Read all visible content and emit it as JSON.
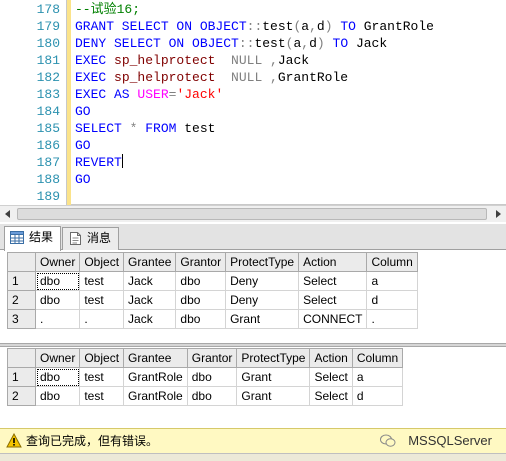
{
  "editor": {
    "line_numbers": [
      "178",
      "179",
      "180",
      "181",
      "182",
      "183",
      "184",
      "185",
      "186",
      "187",
      "188",
      "189"
    ],
    "lines": [
      [
        {
          "t": "--试验16;",
          "c": "cm"
        }
      ],
      [
        {
          "t": "GRANT SELECT ON OBJECT",
          "c": "kw"
        },
        {
          "t": "::",
          "c": "gr"
        },
        {
          "t": "test",
          "c": "df"
        },
        {
          "t": "(",
          "c": "gr"
        },
        {
          "t": "a",
          "c": "df"
        },
        {
          "t": ",",
          "c": "gr"
        },
        {
          "t": "d",
          "c": "df"
        },
        {
          "t": ")",
          "c": "gr"
        },
        {
          "t": " TO ",
          "c": "kw"
        },
        {
          "t": "GrantRole",
          "c": "df"
        }
      ],
      [
        {
          "t": "DENY SELECT ON OBJECT",
          "c": "kw"
        },
        {
          "t": "::",
          "c": "gr"
        },
        {
          "t": "test",
          "c": "df"
        },
        {
          "t": "(",
          "c": "gr"
        },
        {
          "t": "a",
          "c": "df"
        },
        {
          "t": ",",
          "c": "gr"
        },
        {
          "t": "d",
          "c": "df"
        },
        {
          "t": ")",
          "c": "gr"
        },
        {
          "t": " TO ",
          "c": "kw"
        },
        {
          "t": "Jack",
          "c": "df"
        }
      ],
      [
        {
          "t": "EXEC ",
          "c": "kw"
        },
        {
          "t": "sp_helprotect",
          "c": "fn"
        },
        {
          "t": "  NULL ,",
          "c": "gr"
        },
        {
          "t": "Jack",
          "c": "df"
        }
      ],
      [
        {
          "t": "EXEC ",
          "c": "kw"
        },
        {
          "t": "sp_helprotect",
          "c": "fn"
        },
        {
          "t": "  NULL ,",
          "c": "gr"
        },
        {
          "t": "GrantRole",
          "c": "df"
        }
      ],
      [
        {
          "t": "EXEC AS ",
          "c": "kw"
        },
        {
          "t": "USER",
          "c": "mg"
        },
        {
          "t": "=",
          "c": "gr"
        },
        {
          "t": "'Jack'",
          "c": "st"
        }
      ],
      [
        {
          "t": "GO",
          "c": "kw"
        }
      ],
      [
        {
          "t": "SELECT ",
          "c": "kw"
        },
        {
          "t": "*",
          "c": "gr"
        },
        {
          "t": " FROM ",
          "c": "kw"
        },
        {
          "t": "test",
          "c": "df"
        }
      ],
      [
        {
          "t": "GO",
          "c": "kw"
        }
      ],
      [
        {
          "t": "REVERT",
          "c": "kw"
        }
      ],
      [
        {
          "t": "GO",
          "c": "kw"
        }
      ],
      []
    ]
  },
  "tabs": {
    "results": "结果",
    "messages": "消息"
  },
  "grid1": {
    "columns": [
      "Owner",
      "Object",
      "Grantee",
      "Grantor",
      "ProtectType",
      "Action",
      "Column"
    ],
    "rows": [
      {
        "n": "1",
        "cells": [
          "dbo",
          "test",
          "Jack",
          "dbo",
          "Deny",
          "Select",
          "a"
        ]
      },
      {
        "n": "2",
        "cells": [
          "dbo",
          "test",
          "Jack",
          "dbo",
          "Deny",
          "Select",
          "d"
        ]
      },
      {
        "n": "3",
        "cells": [
          ".",
          ".",
          "Jack",
          "dbo",
          "Grant",
          "CONNECT",
          "."
        ]
      }
    ]
  },
  "grid2": {
    "columns": [
      "Owner",
      "Object",
      "Grantee",
      "Grantor",
      "ProtectType",
      "Action",
      "Column"
    ],
    "rows": [
      {
        "n": "1",
        "cells": [
          "dbo",
          "test",
          "GrantRole",
          "dbo",
          "Grant",
          "Select",
          "a"
        ]
      },
      {
        "n": "2",
        "cells": [
          "dbo",
          "test",
          "GrantRole",
          "dbo",
          "Grant",
          "Select",
          "d"
        ]
      }
    ]
  },
  "status": {
    "message": "查询已完成，但有错误。",
    "watermark": "MSSQLServer",
    "icon": "warning-icon"
  }
}
